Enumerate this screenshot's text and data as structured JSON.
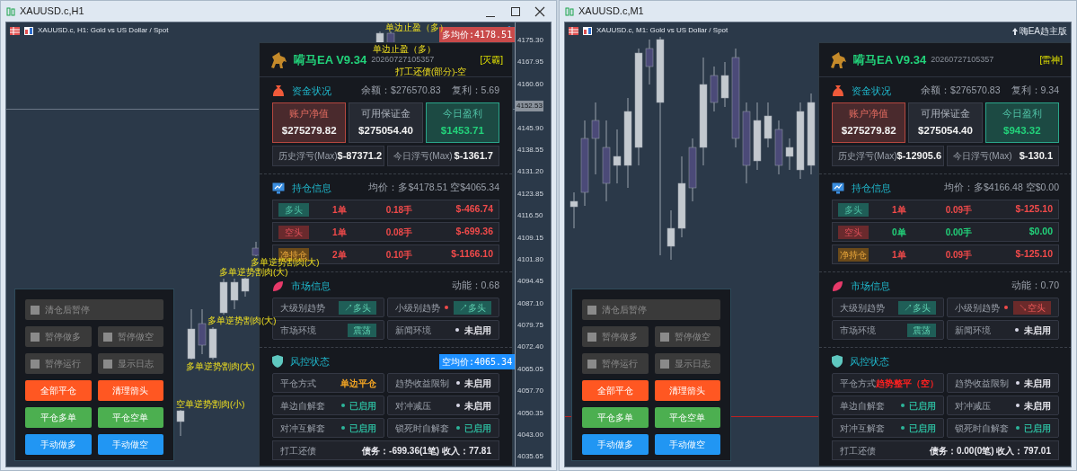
{
  "windows": [
    {
      "title": "XAUUSD.c,H1",
      "controls": true,
      "chart_header": "XAUUSD.c, H1:  Gold vs US Dollar / Spot",
      "price_axis": [
        {
          "kind": "tick",
          "text": "4175.30"
        },
        {
          "kind": "tick",
          "text": "4167.95"
        },
        {
          "kind": "tick",
          "text": "4160.60"
        },
        {
          "kind": "current",
          "text": "4152.53"
        },
        {
          "kind": "tick",
          "text": "4145.90"
        },
        {
          "kind": "tick",
          "text": "4138.55"
        },
        {
          "kind": "tick",
          "text": "4131.20"
        },
        {
          "kind": "tick",
          "text": "4123.85"
        },
        {
          "kind": "tick",
          "text": "4116.50"
        },
        {
          "kind": "tick",
          "text": "4109.15"
        },
        {
          "kind": "tick",
          "text": "4101.80"
        },
        {
          "kind": "tick",
          "text": "4094.45"
        },
        {
          "kind": "tick",
          "text": "4087.10"
        },
        {
          "kind": "tick",
          "text": "4079.75"
        },
        {
          "kind": "tick",
          "text": "4072.40"
        },
        {
          "kind": "tick",
          "text": "4065.05"
        },
        {
          "kind": "tick",
          "text": "4057.70"
        },
        {
          "kind": "tick",
          "text": "4050.35"
        },
        {
          "kind": "tick",
          "text": "4043.00"
        },
        {
          "kind": "tick",
          "text": "4035.65"
        }
      ],
      "price_tags": [
        {
          "kind": "long",
          "text": "多均价:4178.51"
        },
        {
          "kind": "short",
          "text": "空均价:4065.34"
        }
      ],
      "annotations": [
        "单边止盈（多）",
        "单边止盈（多）",
        "打工还债(部分)-空",
        "多单逆势割肉(大)",
        "多单逆势割肉(大)",
        "多单逆势割肉(大)",
        "多单逆势割肉(大)",
        "空单逆势割肉(小)"
      ],
      "controls_panel": {
        "checks": [
          {
            "label": "清仓后暂停",
            "checked": false
          },
          {
            "label": "暂停做多",
            "checked": false
          },
          {
            "label": "暂停做空",
            "checked": false
          },
          {
            "label": "暂停运行",
            "checked": false
          },
          {
            "label": "显示日志",
            "checked": false
          }
        ],
        "buttons": [
          {
            "label": "全部平仓",
            "kind": "danger"
          },
          {
            "label": "清理箭头",
            "kind": "danger"
          },
          {
            "label": "平仓多单",
            "kind": "success"
          },
          {
            "label": "平仓空单",
            "kind": "success"
          },
          {
            "label": "手动做多",
            "kind": "primary"
          },
          {
            "label": "手动做空",
            "kind": "primary"
          }
        ]
      },
      "dashboard": {
        "name": "嗬马EA V9.34",
        "build": "20260727105357",
        "mode": "[灭霸]",
        "funds": {
          "title": "资金状况",
          "balance": "余额：$276570.83",
          "compound": "复利：5.69",
          "cards": [
            {
              "kind": "equity",
              "label": "账户净值",
              "value": "$275279.82"
            },
            {
              "kind": "margin",
              "label": "可用保证金",
              "value": "$275054.40"
            },
            {
              "kind": "profit",
              "label": "今日盈利",
              "value": "$1453.71"
            }
          ],
          "floats": [
            {
              "label": "历史浮亏(Max)",
              "value": "$-87371.2"
            },
            {
              "label": "今日浮亏(Max)",
              "value": "$-1361.7"
            }
          ]
        },
        "positions": {
          "title": "持仓信息",
          "avg": "均价：多$4178.51  空$4065.34",
          "rows": [
            {
              "kind": "long",
              "tag": "多头",
              "orders": "1单",
              "lots": "0.18手",
              "pnl": "$-466.74",
              "color": "#f04a4a"
            },
            {
              "kind": "short",
              "tag": "空头",
              "orders": "1单",
              "lots": "0.08手",
              "pnl": "$-699.36",
              "color": "#f04a4a"
            },
            {
              "kind": "net",
              "tag": "净持仓",
              "orders": "2单",
              "lots": "0.10手",
              "pnl": "$-1166.10",
              "color": "#f04a4a"
            }
          ]
        },
        "market": {
          "title": "市场信息",
          "momentum": "动能：0.68",
          "rows": [
            {
              "label": "大级别趋势",
              "kind": "bullish",
              "value": "↗多头",
              "dot": false
            },
            {
              "label": "小级别趋势",
              "kind": "bullish",
              "value": "↗多头",
              "dot": true
            },
            {
              "label": "市场环境",
              "kind": "ranging",
              "value": "震荡",
              "dot": false
            },
            {
              "label": "新闻环境",
              "kind": "off",
              "value": "未启用",
              "dot": false
            }
          ]
        },
        "risk": {
          "title": "风控状态",
          "rows": [
            {
              "label": "平仓方式",
              "kind": "text",
              "color": "#f5a623",
              "value": "单边平仓"
            },
            {
              "label": "趋势收益限制",
              "kind": "off",
              "value": "未启用"
            },
            {
              "label": "单边自解套",
              "kind": "on",
              "value": "已启用"
            },
            {
              "label": "对冲减压",
              "kind": "off",
              "value": "未启用"
            },
            {
              "label": "对冲互解套",
              "kind": "on",
              "value": "已启用"
            },
            {
              "label": "锁死时自解套",
              "kind": "on",
              "value": "已启用"
            }
          ],
          "debt": {
            "label": "打工还债",
            "value": "债务：-699.36(1笔) 收入：77.81"
          }
        }
      }
    },
    {
      "title": "XAUUSD.c,M1",
      "controls": false,
      "chart_header": "XAUUSD.c, M1:  Gold vs US Dollar / Spot",
      "corner_label": "嗨EA趋主版",
      "controls_panel": {
        "checks": [
          {
            "label": "清仓后暂停",
            "checked": false
          },
          {
            "label": "暂停做多",
            "checked": false
          },
          {
            "label": "暂停做空",
            "checked": false
          },
          {
            "label": "暂停运行",
            "checked": false
          },
          {
            "label": "显示日志",
            "checked": false
          }
        ],
        "buttons": [
          {
            "label": "全部平仓",
            "kind": "danger"
          },
          {
            "label": "清理箭头",
            "kind": "danger"
          },
          {
            "label": "平仓多单",
            "kind": "success"
          },
          {
            "label": "平仓空单",
            "kind": "success"
          },
          {
            "label": "手动做多",
            "kind": "primary"
          },
          {
            "label": "手动做空",
            "kind": "primary"
          }
        ]
      },
      "dashboard": {
        "name": "嗬马EA V9.34",
        "build": "20260727105357",
        "mode": "[雷神]",
        "funds": {
          "title": "资金状况",
          "balance": "余额：$276570.83",
          "compound": "复利：9.34",
          "cards": [
            {
              "kind": "equity",
              "label": "账户净值",
              "value": "$275279.82"
            },
            {
              "kind": "margin",
              "label": "可用保证金",
              "value": "$275054.40"
            },
            {
              "kind": "profit",
              "label": "今日盈利",
              "value": "$943.32"
            }
          ],
          "floats": [
            {
              "label": "历史浮亏(Max)",
              "value": "$-12905.6"
            },
            {
              "label": "今日浮亏(Max)",
              "value": "$-130.1"
            }
          ]
        },
        "positions": {
          "title": "持仓信息",
          "avg": "均价：多$4166.48  空$0.00",
          "rows": [
            {
              "kind": "long",
              "tag": "多头",
              "orders": "1单",
              "lots": "0.09手",
              "pnl": "$-125.10",
              "color": "#f04a4a"
            },
            {
              "kind": "short",
              "tag": "空头",
              "orders": "0单",
              "lots": "0.00手",
              "pnl": "$0.00",
              "color": "#22d27a"
            },
            {
              "kind": "net",
              "tag": "净持仓",
              "orders": "1单",
              "lots": "0.09手",
              "pnl": "$-125.10",
              "color": "#f04a4a"
            }
          ]
        },
        "market": {
          "title": "市场信息",
          "momentum": "动能：0.70",
          "rows": [
            {
              "label": "大级别趋势",
              "kind": "bullish",
              "value": "↗多头",
              "dot": false
            },
            {
              "label": "小级别趋势",
              "kind": "bearish",
              "value": "↘空头",
              "dot": true
            },
            {
              "label": "市场环境",
              "kind": "ranging",
              "value": "震荡",
              "dot": false
            },
            {
              "label": "新闻环境",
              "kind": "off",
              "value": "未启用",
              "dot": false
            }
          ]
        },
        "risk": {
          "title": "风控状态",
          "rows": [
            {
              "label": "平仓方式",
              "kind": "text",
              "color": "#ff2020",
              "value": "趋势整平（空）"
            },
            {
              "label": "趋势收益限制",
              "kind": "off",
              "value": "未启用"
            },
            {
              "label": "单边自解套",
              "kind": "on",
              "value": "已启用"
            },
            {
              "label": "对冲减压",
              "kind": "off",
              "value": "未启用"
            },
            {
              "label": "对冲互解套",
              "kind": "on",
              "value": "已启用"
            },
            {
              "label": "锁死时自解套",
              "kind": "on",
              "value": "已启用"
            }
          ],
          "debt": {
            "label": "打工还债",
            "value": "债务：0.00(0笔) 收入：797.01"
          }
        }
      }
    }
  ]
}
